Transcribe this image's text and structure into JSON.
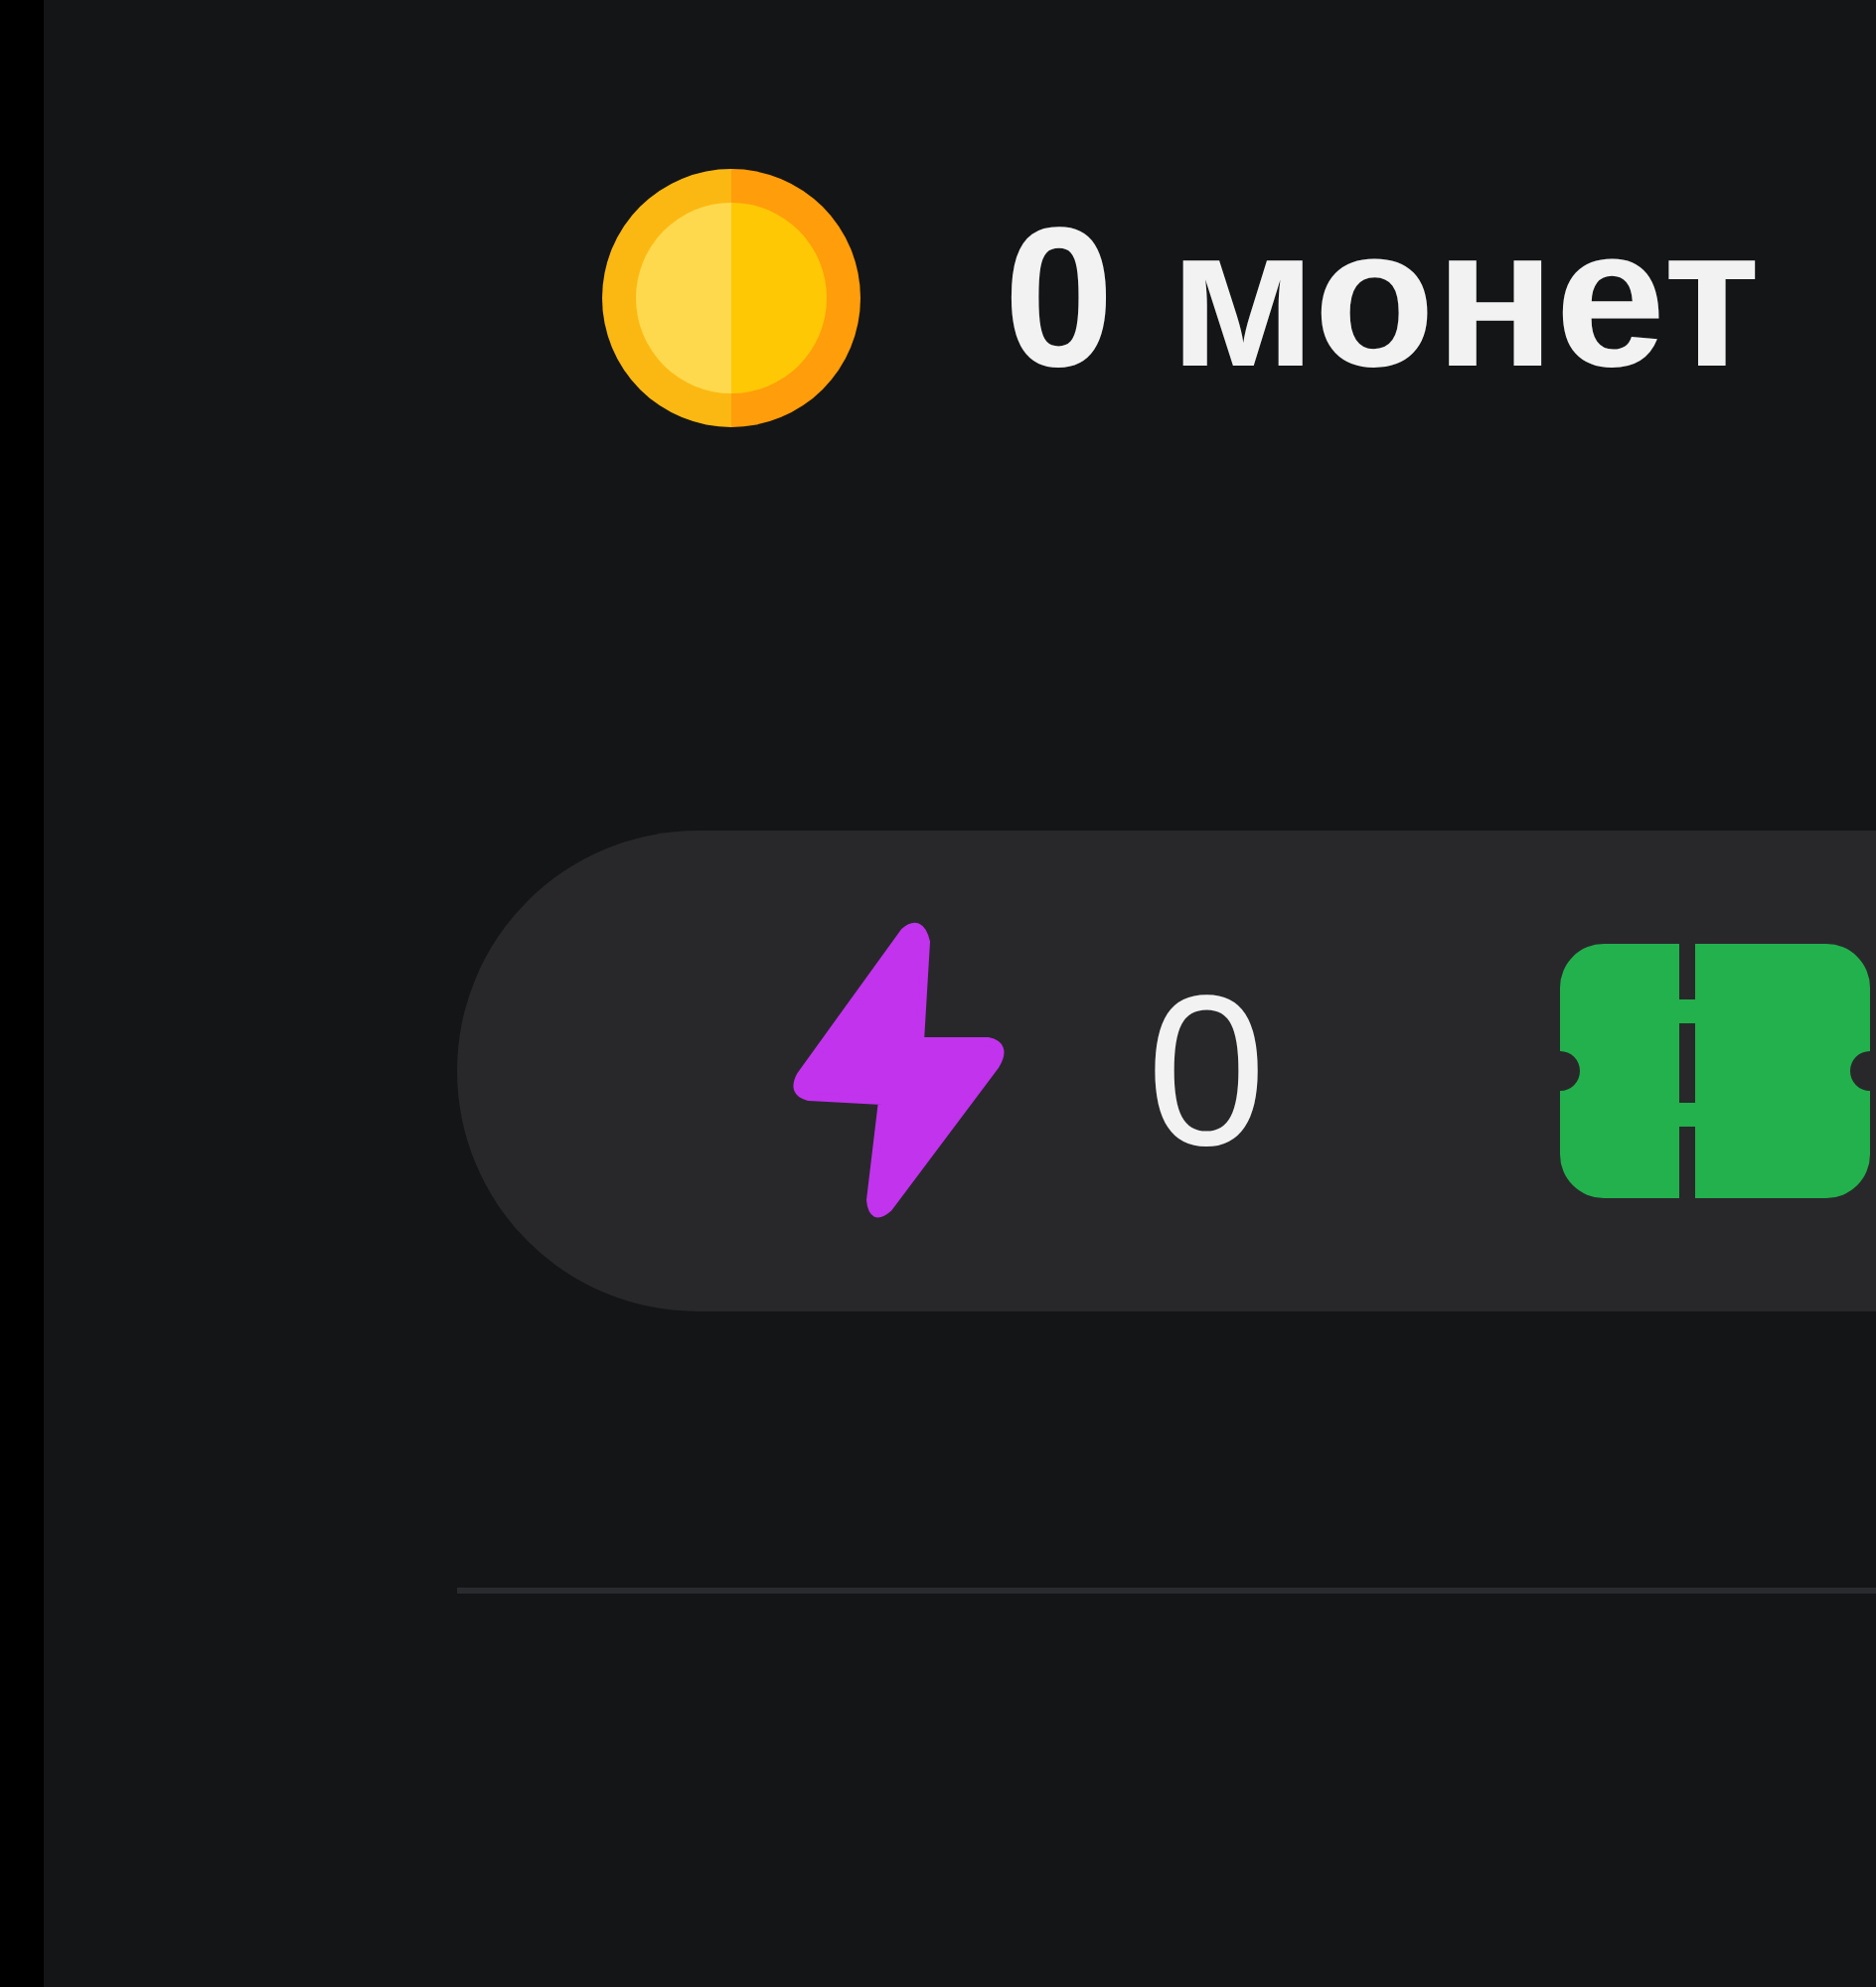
{
  "balance": {
    "text": "0 монет"
  },
  "stats": [
    {
      "kind": "energy",
      "value": "0"
    },
    {
      "kind": "ticket"
    }
  ]
}
